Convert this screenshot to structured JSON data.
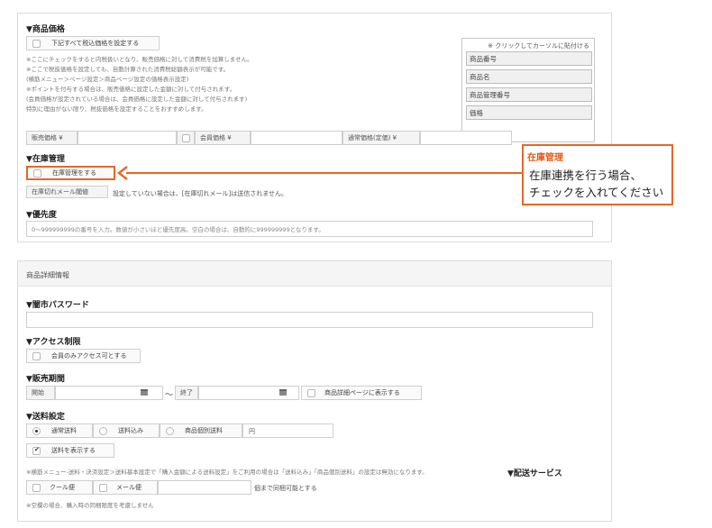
{
  "price": {
    "heading": "▼商品価格",
    "tax_button": "下記すべて税込価格を設定する",
    "notes": [
      "※ここにチェックをすると内税扱いとなり、販売価格に対して消費税を加算しません。",
      "※ここで税抜価格を設定しても、自動計算された消費税総額表示が可能です。",
      "(横筋メニュー＞ページ設定＞商品ページ設定の価格表示設定)",
      "※ポイントを付与する場合は、販売価格に設定した金額に対して付与されます。",
      "(会員価格が設定されている場合は、会員価格に設定した金額に対して付与されます)",
      "特別に理由がない限り、税抜価格を設定することをおすすめします。"
    ],
    "sale_price_label": "販売価格 ¥",
    "member_price_label": "会員価格 ¥",
    "regular_price_label": "通常価格(定価) ¥"
  },
  "keyword_box": {
    "title": "※ クリックしてカーソルに貼付ける",
    "items": [
      "商品番号",
      "商品名",
      "商品管理番号",
      "価格"
    ]
  },
  "stock": {
    "heading": "▼在庫管理",
    "manage_button": "在庫管理をする",
    "threshold_label": "在庫切れメール閾値",
    "threshold_note": "設定していない場合は、[在庫切れメール]は送信されません。"
  },
  "priority": {
    "heading": "▼優先度",
    "placeholder": "0～999999999の番号を入力。数値が小さいほど優先度高。空白の場合は、自動的に999999999となります。"
  },
  "callout": {
    "heading": "在庫管理",
    "line1": "在庫連携を行う場合、",
    "line2": "チェックを入れてください"
  },
  "detail": {
    "panel_title": "商品詳細情報",
    "password_heading": "▼闇市パスワード",
    "access_heading": "▼アクセス制限",
    "access_button": "会員のみアクセス可とする",
    "period_heading": "▼販売期間",
    "start_label": "開始",
    "tilde": "～",
    "end_label": "終了",
    "show_detail_button": "商品詳細ページに表示する",
    "shipping_heading": "▼送料設定",
    "ship_normal": "通常送料",
    "ship_included": "送料込み",
    "ship_individual": "商品個別送料",
    "yen": "円",
    "show_shipping": "送料を表示する",
    "shipping_note": "※横筋メニュー-送料・決済設定＞送料基本設定で「購入金額による送料設定」をご利用の場合は「送料込み」「商品個別送料」の設定は無効になります。",
    "delivery_heading": "▼配送サービス",
    "cool_label": "クール便",
    "mail_label": "メール便",
    "bundle_label": "個まで同梱可能とする",
    "bundle_note": "※空欄の場合、購入時の同梱限度を考慮しません"
  }
}
